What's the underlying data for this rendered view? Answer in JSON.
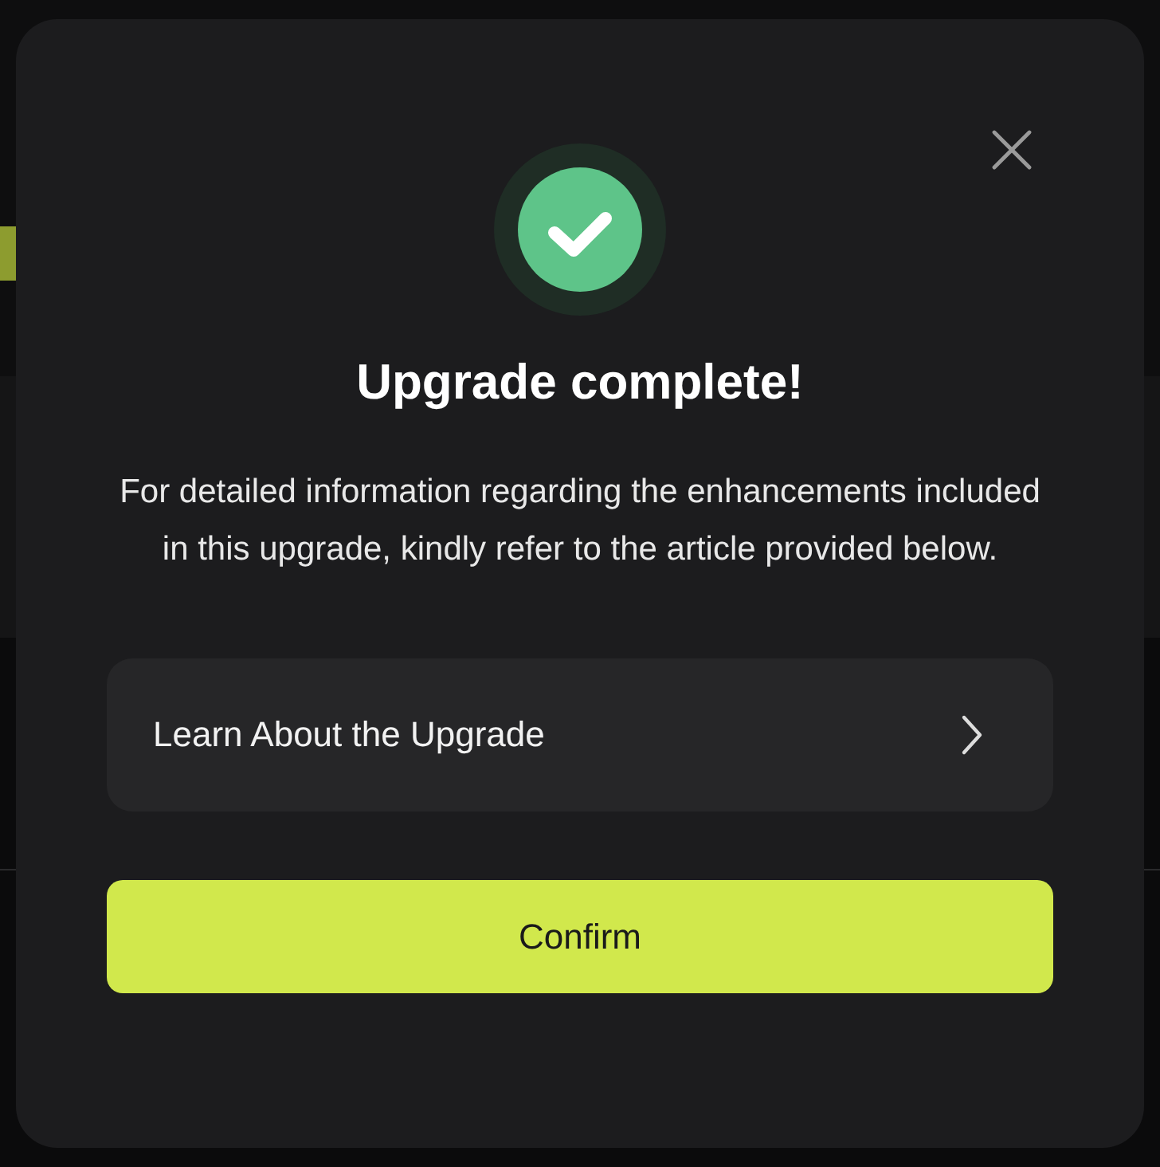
{
  "dialog": {
    "title": "Upgrade complete!",
    "message": "For detailed information regarding the enhancements included in this upgrade, kindly refer to the article provided below.",
    "link": {
      "label": "Learn About the Upgrade"
    },
    "confirm": "Confirm"
  }
}
